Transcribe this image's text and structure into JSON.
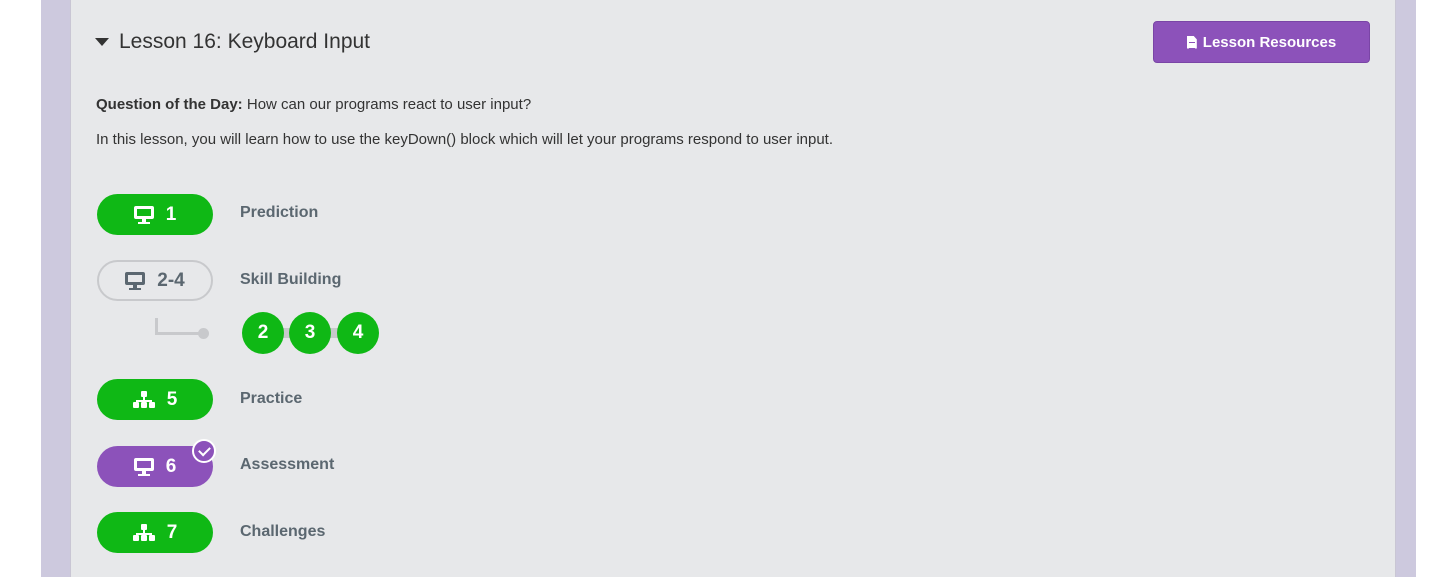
{
  "lesson": {
    "title": "Lesson 16: Keyboard Input",
    "resources_label": "Lesson Resources",
    "qotd_label": "Question of the Day:",
    "qotd_text": " How can our programs react to user input?",
    "description": "In this lesson, you will learn how to use the keyDown() block which will let your programs respond to user input."
  },
  "levels": [
    {
      "number": "1",
      "name": "Prediction",
      "icon": "monitor-icon",
      "status": "completed"
    },
    {
      "number": "2-4",
      "name": "Skill Building",
      "icon": "monitor-icon",
      "status": "not-started",
      "sublevels": [
        "2",
        "3",
        "4"
      ]
    },
    {
      "number": "5",
      "name": "Practice",
      "icon": "sitemap-icon",
      "status": "completed"
    },
    {
      "number": "6",
      "name": "Assessment",
      "icon": "monitor-icon",
      "status": "submitted"
    },
    {
      "number": "7",
      "name": "Challenges",
      "icon": "sitemap-icon",
      "status": "completed"
    }
  ],
  "colors": {
    "completed": "#0fb815",
    "submitted": "#8c52ba",
    "accent": "#8c52ba"
  }
}
